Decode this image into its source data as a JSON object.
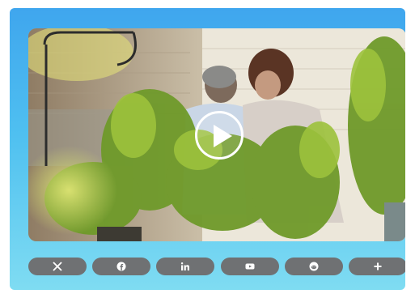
{
  "video": {
    "play_icon": "play-icon"
  },
  "share": {
    "button_color": "#6f7173",
    "buttons": [
      {
        "icon": "x-logo-icon"
      },
      {
        "icon": "facebook-icon"
      },
      {
        "icon": "linkedin-icon"
      },
      {
        "icon": "youtube-icon"
      },
      {
        "icon": "reddit-icon"
      },
      {
        "icon": "plus-icon"
      }
    ]
  },
  "colors": {
    "card_gradient_top": "#3fa6ee",
    "card_gradient_bottom": "#7fdcf2",
    "icon": "#ffffff"
  }
}
